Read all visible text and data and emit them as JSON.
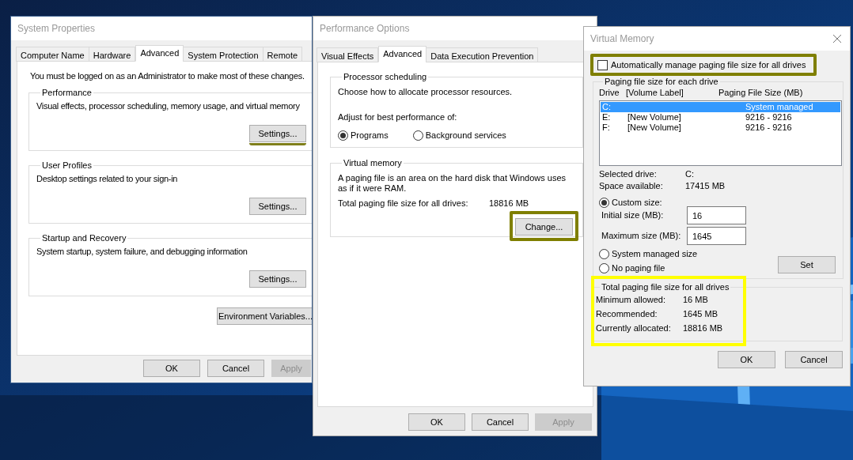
{
  "system_properties": {
    "title": "System Properties",
    "tabs": [
      {
        "label": "Computer Name",
        "selected": false
      },
      {
        "label": "Hardware",
        "selected": false
      },
      {
        "label": "Advanced",
        "selected": true
      },
      {
        "label": "System Protection",
        "selected": false
      },
      {
        "label": "Remote",
        "selected": false
      }
    ],
    "notice": "You must be logged on as an Administrator to make most of these changes.",
    "groups": [
      {
        "title": "Performance",
        "description": "Visual effects, processor scheduling, memory usage, and virtual memory",
        "button": "Settings...",
        "highlighted": true
      },
      {
        "title": "User Profiles",
        "description": "Desktop settings related to your sign-in",
        "button": "Settings...",
        "highlighted": false
      },
      {
        "title": "Startup and Recovery",
        "description": "System startup, system failure, and debugging information",
        "button": "Settings...",
        "highlighted": false
      }
    ],
    "env_button": "Environment Variables...",
    "buttons": [
      {
        "label": "OK",
        "disabled": false
      },
      {
        "label": "Cancel",
        "disabled": false
      },
      {
        "label": "Apply",
        "disabled": true
      }
    ]
  },
  "performance_options": {
    "title": "Performance Options",
    "tabs": [
      {
        "label": "Visual Effects",
        "selected": false
      },
      {
        "label": "Advanced",
        "selected": true
      },
      {
        "label": "Data Execution Prevention",
        "selected": false
      }
    ],
    "processor_group": {
      "title": "Processor scheduling",
      "description": "Choose how to allocate processor resources.",
      "prompt": "Adjust for best performance of:",
      "options": [
        {
          "label": "Programs",
          "selected": true
        },
        {
          "label": "Background services",
          "selected": false
        }
      ]
    },
    "memory_group": {
      "title": "Virtual memory",
      "description": "A paging file is an area on the hard disk that Windows uses as if it were RAM.",
      "total_label": "Total paging file size for all drives:",
      "total_value": "18816 MB",
      "button": "Change...",
      "highlighted": true
    },
    "buttons": [
      {
        "label": "OK",
        "disabled": false
      },
      {
        "label": "Cancel",
        "disabled": false
      },
      {
        "label": "Apply",
        "disabled": true
      }
    ]
  },
  "virtual_memory": {
    "title": "Virtual Memory",
    "auto_manage": {
      "label": "Automatically manage paging file size for all drives",
      "checked": false,
      "highlighted": true
    },
    "drive_group": {
      "title": "Paging file size for each drive",
      "columns": [
        "Drive",
        "[Volume Label]",
        "Paging File Size (MB)"
      ],
      "rows": [
        {
          "drive": "C:",
          "size": "System managed",
          "selected": true
        },
        {
          "drive": "E:",
          "volume": "[New Volume]",
          "size": "9216 - 9216",
          "selected": false
        },
        {
          "drive": "F:",
          "volume": "[New Volume]",
          "size": "9216 - 9216",
          "selected": false
        }
      ],
      "info": [
        {
          "label": "Selected drive:",
          "value": "C:"
        },
        {
          "label": "Space available:",
          "value": "17415 MB"
        }
      ],
      "custom_option": {
        "label": "Custom size:",
        "selected": true
      },
      "fields": [
        {
          "label": "Initial size (MB):",
          "value": "16"
        },
        {
          "label": "Maximum size (MB):",
          "value": "1645"
        }
      ],
      "other_options": [
        {
          "label": "System managed size",
          "selected": false
        },
        {
          "label": "No paging file",
          "selected": false
        }
      ],
      "set_button": "Set"
    },
    "totals_group": {
      "title": "Total paging file size for all drives",
      "highlighted": true,
      "rows": [
        {
          "label": "Minimum allowed:",
          "value": "16 MB"
        },
        {
          "label": "Recommended:",
          "value": "1645 MB"
        },
        {
          "label": "Currently allocated:",
          "value": "18816 MB"
        }
      ]
    },
    "buttons": [
      {
        "label": "OK",
        "disabled": false
      },
      {
        "label": "Cancel",
        "disabled": false
      }
    ]
  }
}
